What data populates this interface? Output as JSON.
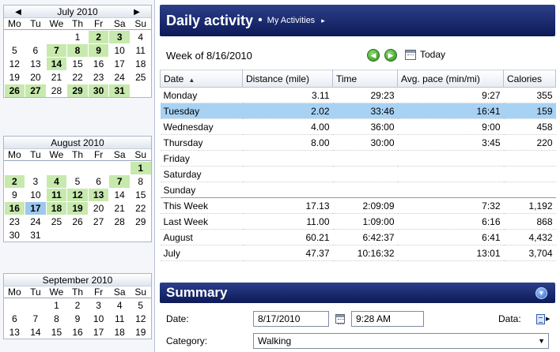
{
  "calendar": {
    "weekdays": [
      "Mo",
      "Tu",
      "We",
      "Th",
      "Fr",
      "Sa",
      "Su"
    ],
    "prev_icon": "arrow-left-icon",
    "next_icon": "arrow-right-icon",
    "months": [
      {
        "name": "July 2010",
        "weeks": [
          [
            {
              "d": ""
            },
            {
              "d": ""
            },
            {
              "d": ""
            },
            {
              "d": "1"
            },
            {
              "d": "2",
              "s": "has"
            },
            {
              "d": "3",
              "s": "has"
            },
            {
              "d": "4"
            }
          ],
          [
            {
              "d": "5"
            },
            {
              "d": "6"
            },
            {
              "d": "7",
              "s": "has"
            },
            {
              "d": "8",
              "s": "has"
            },
            {
              "d": "9",
              "s": "has"
            },
            {
              "d": "10"
            },
            {
              "d": "11"
            }
          ],
          [
            {
              "d": "12"
            },
            {
              "d": "13"
            },
            {
              "d": "14",
              "s": "has"
            },
            {
              "d": "15"
            },
            {
              "d": "16"
            },
            {
              "d": "17"
            },
            {
              "d": "18"
            }
          ],
          [
            {
              "d": "19"
            },
            {
              "d": "20"
            },
            {
              "d": "21"
            },
            {
              "d": "22"
            },
            {
              "d": "23"
            },
            {
              "d": "24"
            },
            {
              "d": "25"
            }
          ],
          [
            {
              "d": "26",
              "s": "has"
            },
            {
              "d": "27",
              "s": "has"
            },
            {
              "d": "28"
            },
            {
              "d": "29",
              "s": "has"
            },
            {
              "d": "30",
              "s": "has"
            },
            {
              "d": "31",
              "s": "has"
            },
            {
              "d": ""
            }
          ]
        ]
      },
      {
        "name": "August 2010",
        "weeks": [
          [
            {
              "d": ""
            },
            {
              "d": ""
            },
            {
              "d": ""
            },
            {
              "d": ""
            },
            {
              "d": ""
            },
            {
              "d": ""
            },
            {
              "d": "1",
              "s": "has"
            }
          ],
          [
            {
              "d": "2",
              "s": "has"
            },
            {
              "d": "3"
            },
            {
              "d": "4",
              "s": "has"
            },
            {
              "d": "5"
            },
            {
              "d": "6"
            },
            {
              "d": "7",
              "s": "has"
            },
            {
              "d": "8"
            }
          ],
          [
            {
              "d": "9"
            },
            {
              "d": "10"
            },
            {
              "d": "11",
              "s": "has"
            },
            {
              "d": "12",
              "s": "has"
            },
            {
              "d": "13",
              "s": "has"
            },
            {
              "d": "14"
            },
            {
              "d": "15"
            }
          ],
          [
            {
              "d": "16",
              "s": "has"
            },
            {
              "d": "17",
              "s": "sel"
            },
            {
              "d": "18",
              "s": "has"
            },
            {
              "d": "19",
              "s": "has"
            },
            {
              "d": "20"
            },
            {
              "d": "21"
            },
            {
              "d": "22"
            }
          ],
          [
            {
              "d": "23"
            },
            {
              "d": "24"
            },
            {
              "d": "25"
            },
            {
              "d": "26"
            },
            {
              "d": "27"
            },
            {
              "d": "28"
            },
            {
              "d": "29"
            }
          ],
          [
            {
              "d": "30"
            },
            {
              "d": "31"
            },
            {
              "d": ""
            },
            {
              "d": ""
            },
            {
              "d": ""
            },
            {
              "d": ""
            },
            {
              "d": ""
            }
          ]
        ]
      },
      {
        "name": "September 2010",
        "weeks": [
          [
            {
              "d": ""
            },
            {
              "d": ""
            },
            {
              "d": "1"
            },
            {
              "d": "2"
            },
            {
              "d": "3"
            },
            {
              "d": "4"
            },
            {
              "d": "5"
            }
          ],
          [
            {
              "d": "6"
            },
            {
              "d": "7"
            },
            {
              "d": "8"
            },
            {
              "d": "9"
            },
            {
              "d": "10"
            },
            {
              "d": "11"
            },
            {
              "d": "12"
            }
          ],
          [
            {
              "d": "13"
            },
            {
              "d": "14"
            },
            {
              "d": "15"
            },
            {
              "d": "16"
            },
            {
              "d": "17"
            },
            {
              "d": "18"
            },
            {
              "d": "19"
            }
          ]
        ]
      }
    ]
  },
  "header": {
    "title": "Daily activity",
    "bullet": "•",
    "link": "My Activities",
    "link_arrow": "▸"
  },
  "week_bar": {
    "label": "Week of 8/16/2010",
    "back_icon": "arrow-back-icon",
    "forward_icon": "arrow-forward-icon",
    "today_label": "Today"
  },
  "grid": {
    "columns": [
      "Date",
      "Distance (mile)",
      "Time",
      "Avg. pace (min/mi)",
      "Calories"
    ],
    "rows": [
      {
        "cells": [
          "Monday",
          "3.11",
          "29:23",
          "9:27",
          "355"
        ]
      },
      {
        "cells": [
          "Tuesday",
          "2.02",
          "33:46",
          "16:41",
          "159"
        ],
        "selected": true
      },
      {
        "cells": [
          "Wednesday",
          "4.00",
          "36:00",
          "9:00",
          "458"
        ]
      },
      {
        "cells": [
          "Thursday",
          "8.00",
          "30:00",
          "3:45",
          "220"
        ]
      },
      {
        "cells": [
          "Friday",
          "",
          "",
          "",
          ""
        ]
      },
      {
        "cells": [
          "Saturday",
          "",
          "",
          "",
          ""
        ]
      },
      {
        "cells": [
          "Sunday",
          "",
          "",
          "",
          ""
        ]
      },
      {
        "cells": [
          "This Week",
          "17.13",
          "2:09:09",
          "7:32",
          "1,192"
        ],
        "sep": true
      },
      {
        "cells": [
          "Last Week",
          "11.00",
          "1:09:00",
          "6:16",
          "868"
        ]
      },
      {
        "cells": [
          "August",
          "60.21",
          "6:42:37",
          "6:41",
          "4,432"
        ]
      },
      {
        "cells": [
          "July",
          "47.37",
          "10:16:32",
          "13:01",
          "3,704"
        ]
      }
    ]
  },
  "summary": {
    "title": "Summary",
    "date_label": "Date:",
    "date_value": "8/17/2010",
    "time_value": "9:28 AM",
    "data_label": "Data:",
    "category_label": "Category:",
    "category_value": "Walking"
  },
  "colors": {
    "header_dark": "#0d1a57",
    "day_has_activity": "#c7e9ad",
    "selected": "#a8d2f4"
  }
}
